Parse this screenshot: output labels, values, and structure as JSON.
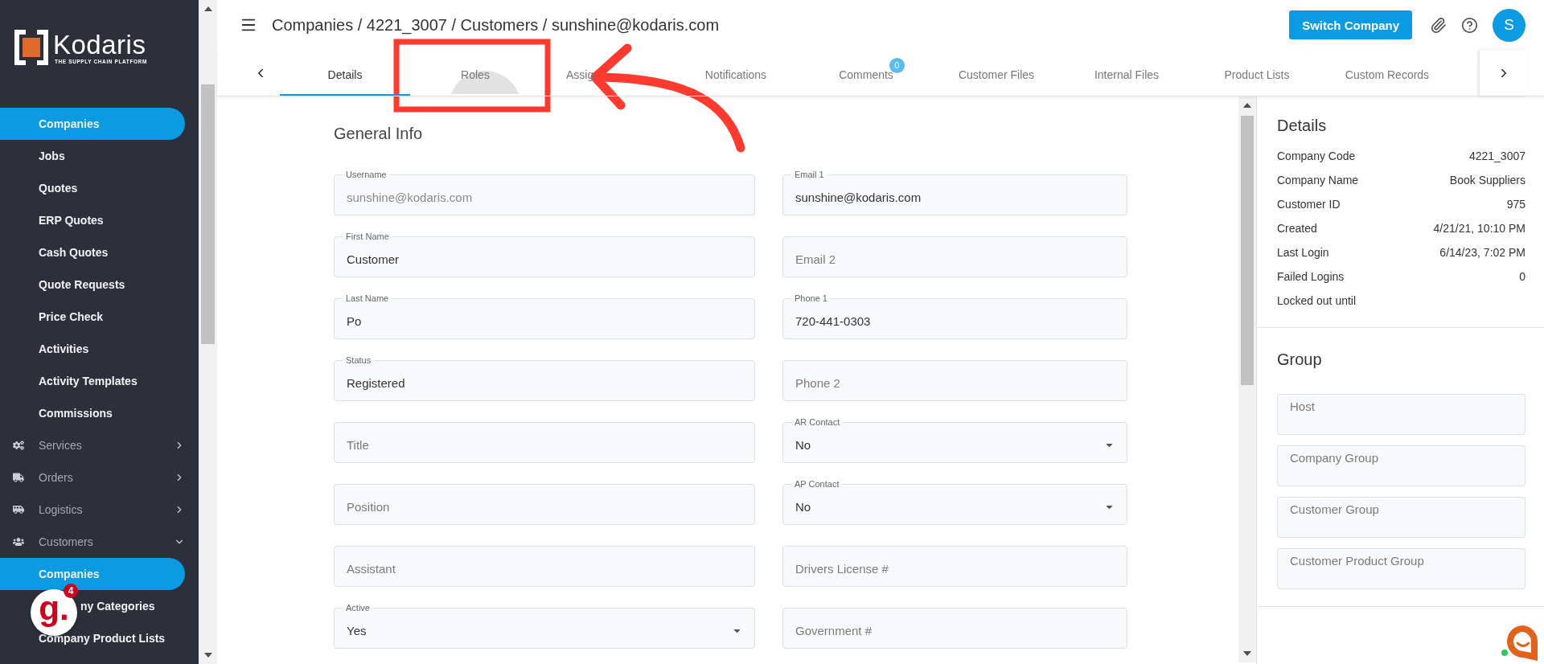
{
  "sidebar": {
    "logo": {
      "name": "Kodaris",
      "tagline": "THE SUPPLY CHAIN PLATFORM"
    },
    "items": [
      {
        "label": "Companies",
        "kind": "link",
        "selected": true
      },
      {
        "label": "Jobs",
        "kind": "link",
        "selected": false
      },
      {
        "label": "Quotes",
        "kind": "link",
        "selected": false
      },
      {
        "label": "ERP Quotes",
        "kind": "link",
        "selected": false
      },
      {
        "label": "Cash Quotes",
        "kind": "link",
        "selected": false
      },
      {
        "label": "Quote Requests",
        "kind": "link",
        "selected": false
      },
      {
        "label": "Price Check",
        "kind": "link",
        "selected": false
      },
      {
        "label": "Activities",
        "kind": "link",
        "selected": false
      },
      {
        "label": "Activity Templates",
        "kind": "link",
        "selected": false
      },
      {
        "label": "Commissions",
        "kind": "link",
        "selected": false
      },
      {
        "label": "Services",
        "kind": "group",
        "selected": false,
        "expanded": false
      },
      {
        "label": "Orders",
        "kind": "group",
        "selected": false,
        "expanded": false
      },
      {
        "label": "Logistics",
        "kind": "group",
        "selected": false,
        "expanded": false
      },
      {
        "label": "Customers",
        "kind": "group",
        "selected": false,
        "expanded": true
      },
      {
        "label": "Companies",
        "kind": "link",
        "selected": true
      },
      {
        "label": "ny Categories",
        "kind": "partial",
        "selected": false
      },
      {
        "label": "Company Product Lists",
        "kind": "link",
        "selected": false
      }
    ]
  },
  "widget": {
    "logo": "g.",
    "count": "4"
  },
  "header": {
    "breadcrumb": "Companies / 4221_3007 / Customers / sunshine@kodaris.com",
    "switch_button": "Switch Company",
    "avatar": "S"
  },
  "tabs": [
    {
      "label": "Details",
      "selected": true,
      "pressed": false,
      "covered": false
    },
    {
      "label": "Roles",
      "selected": false,
      "pressed": true,
      "covered": false
    },
    {
      "label": "Assig",
      "selected": false,
      "pressed": false,
      "covered": true
    },
    {
      "label": "Notifications",
      "selected": false,
      "pressed": false,
      "covered": false
    },
    {
      "label": "Comments",
      "selected": false,
      "pressed": false,
      "covered": false,
      "badge": "0"
    },
    {
      "label": "Customer Files",
      "selected": false,
      "pressed": false,
      "covered": false
    },
    {
      "label": "Internal Files",
      "selected": false,
      "pressed": false,
      "covered": false
    },
    {
      "label": "Product Lists",
      "selected": false,
      "pressed": false,
      "covered": false
    },
    {
      "label": "Custom Records",
      "selected": false,
      "pressed": false,
      "covered": false
    }
  ],
  "form": {
    "title": "General Info",
    "fields": [
      {
        "kind": "text",
        "label": "Username",
        "value": "sunshine@kodaris.com",
        "disabled": true
      },
      {
        "kind": "text",
        "label": "First Name",
        "value": "Customer",
        "disabled": false
      },
      {
        "kind": "text",
        "label": "Last Name",
        "value": "Po",
        "disabled": false
      },
      {
        "kind": "text",
        "label": "Status",
        "value": "Registered",
        "disabled": false
      },
      {
        "kind": "text",
        "placeholder": "Title",
        "disabled": false
      },
      {
        "kind": "text",
        "placeholder": "Position",
        "disabled": false
      },
      {
        "kind": "text",
        "placeholder": "Assistant",
        "disabled": false
      },
      {
        "kind": "select",
        "label": "Active",
        "value": "Yes",
        "disabled": false
      },
      {
        "kind": "text",
        "label": "Email 1",
        "value": "sunshine@kodaris.com",
        "disabled": false
      },
      {
        "kind": "text",
        "placeholder": "Email 2",
        "disabled": false
      },
      {
        "kind": "text",
        "label": "Phone 1",
        "value": "720-441-0303",
        "disabled": false
      },
      {
        "kind": "text",
        "placeholder": "Phone 2",
        "disabled": false
      },
      {
        "kind": "select",
        "label": "AR Contact",
        "value": "No",
        "disabled": false
      },
      {
        "kind": "select",
        "label": "AP Contact",
        "value": "No",
        "disabled": false
      },
      {
        "kind": "text",
        "placeholder": "Drivers License #",
        "disabled": false
      },
      {
        "kind": "text",
        "placeholder": "Government #",
        "disabled": false
      }
    ]
  },
  "details_panel": {
    "title": "Details",
    "rows": [
      {
        "label": "Company Code",
        "value": "4221_3007"
      },
      {
        "label": "Company Name",
        "value": "Book Suppliers"
      },
      {
        "label": "Customer ID",
        "value": "975"
      },
      {
        "label": "Created",
        "value": "4/21/21, 10:10 PM"
      },
      {
        "label": "Last Login",
        "value": "6/14/23, 7:02 PM"
      },
      {
        "label": "Failed Logins",
        "value": "0"
      },
      {
        "label": "Locked out until"
      }
    ]
  },
  "group_panel": {
    "title": "Group",
    "fields": [
      {
        "placeholder": "Host"
      },
      {
        "placeholder": "Company Group"
      },
      {
        "placeholder": "Customer Group"
      },
      {
        "placeholder": "Customer Product Group"
      }
    ]
  }
}
